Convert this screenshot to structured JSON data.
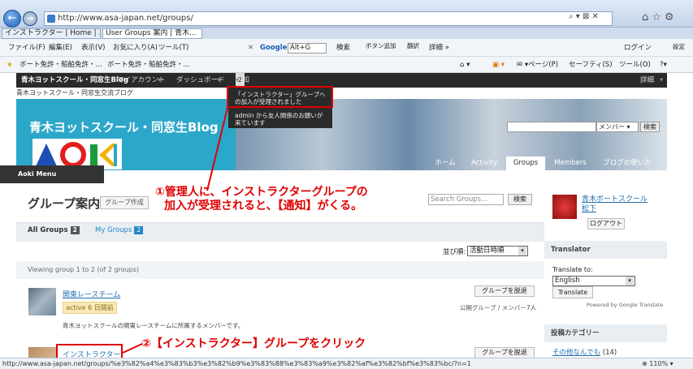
{
  "browser": {
    "url": "http://www.asa-japan.net/groups/",
    "window_title": "",
    "tabs": [
      {
        "label": "インストラクター | Home | ..."
      },
      {
        "label": "User Groups 案内 | 青木..."
      }
    ],
    "menu": [
      "ファイル(F)",
      "編集(E)",
      "表示(V)",
      "お気に入り(A)",
      "ツール(T)"
    ],
    "search_box": "Alt+G",
    "toolbar_google": "Google",
    "toolbar_search": "検索",
    "toolbar_add_button": "ボタン追加",
    "toolbar_translate": "翻訳",
    "toolbar_details": "詳細 »",
    "login": "ログイン",
    "settings": "設定",
    "favorites": [
      "ボート免許・船舶免許・...",
      "ボート免許・船舶免許・..."
    ],
    "command_bar": [
      "ページ(P)",
      "セーフティ(S)",
      "ツール(O)"
    ],
    "status_url": "http://www.asa-japan.net/groups/%e3%82%a4%e3%83%b3%e3%82%b9%e3%83%88%e3%83%a9%e3%82%af%e3%82%bf%e3%83%bc/?n=1",
    "zoom": "110%"
  },
  "admin_bar": {
    "site": "青木ヨットスクール・同窓生Blog",
    "my_account": "マイアカウント",
    "dashboard": "ダッシュボード",
    "notifications": "通知",
    "notif_count": "2",
    "right_label": "詳細"
  },
  "notifications_popup": {
    "item1": "「インストラクター」グループへの加入が受理されました",
    "item2": "admin から友人関係のお願いが来ています"
  },
  "blog": {
    "subtitle": "青木ヨットスクール・同窓生交流ブログ",
    "title": "青木ヨットスクール・同窓生Blog",
    "logo": "AOKI",
    "search_select": "メンバー",
    "search_button": "検索",
    "nav": [
      "ホーム",
      "Activity",
      "Groups",
      "Members",
      "ブログの使い方"
    ]
  },
  "aoki_menu": "Aoki Menu",
  "groups": {
    "title": "グループ案内",
    "create_button": "グループ作成",
    "search_placeholder": "Search Groups...",
    "search_button": "検索",
    "tab_all": "All Groups",
    "tab_all_count": "2",
    "tab_my": "My Groups",
    "tab_my_count": "2",
    "sort_label": "並び順:",
    "sort_value": "活動日時順",
    "viewing": "Viewing group 1 to 2 (of 2 groups)",
    "items": [
      {
        "name": "関東レースチーム",
        "active": "active 6 日間前",
        "desc": "青木ヨットスクールの関東レースチームに所属するメンバーです。",
        "leave": "グループを脱退",
        "meta": "公開グループ / メンバー7人"
      },
      {
        "name": "インストラクター",
        "leave": "グループを脱退"
      }
    ]
  },
  "sidebar": {
    "user_name_line1": "青木ボートスクール",
    "user_name_line2": "松下",
    "logout": "ログアウト",
    "translator_head": "Translator",
    "translate_to": "Translate to:",
    "language": "English",
    "translate_button": "Translate",
    "powered": "Powered by Google Translate",
    "category_head": "投稿カテゴリー",
    "category_item": "その他なんでも",
    "category_count": "(14)"
  },
  "annotations": {
    "step1_line1": "①管理人に、インストラクターグループの",
    "step1_line2": "加入が受理されると、【通知】がくる。",
    "step2": "②【インストラクター】グループをクリック"
  },
  "colors": {
    "header": "#2ba7c9",
    "annotation": "#e00000",
    "admin_bar": "#2a2a2a"
  }
}
